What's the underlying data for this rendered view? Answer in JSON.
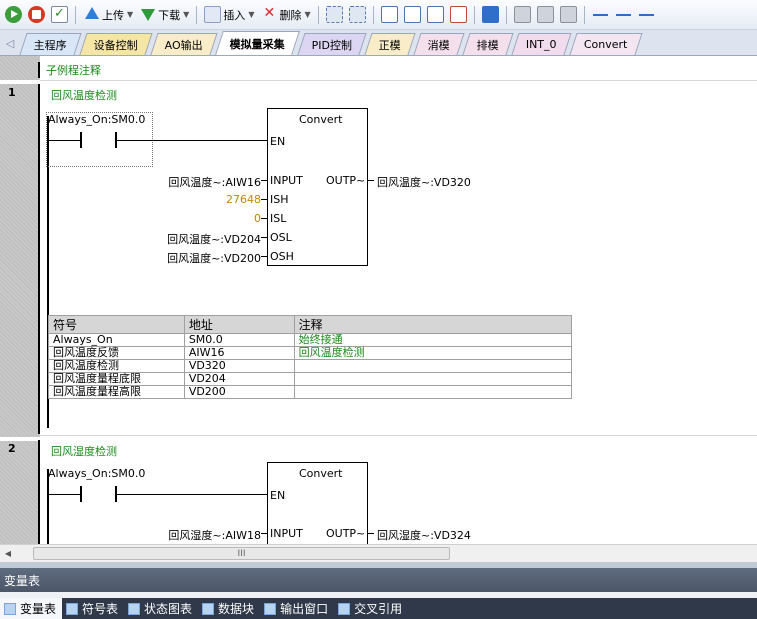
{
  "toolbar": {
    "upload_label": "上传",
    "download_label": "下载",
    "insert_label": "插入",
    "delete_label": "删除"
  },
  "tabs": [
    {
      "label": "主程序",
      "color": "#d8e6f8"
    },
    {
      "label": "设备控制",
      "color": "#f5e6a6"
    },
    {
      "label": "AO输出",
      "color": "#f8ecc9"
    },
    {
      "label": "模拟量采集",
      "color": "#ffffff"
    },
    {
      "label": "PID控制",
      "color": "#dcd6f2"
    },
    {
      "label": "正模",
      "color": "#f8ecc9"
    },
    {
      "label": "消模",
      "color": "#f3e0ec"
    },
    {
      "label": "排模",
      "color": "#f3e0ec"
    },
    {
      "label": "INT_0",
      "color": "#f0dcec"
    },
    {
      "label": "Convert",
      "color": "#f3e6f2"
    }
  ],
  "editor": {
    "subroutine_comment": "子例程注释",
    "networks": [
      {
        "number": "1",
        "title": "回风温度检测",
        "contact_label": "Always_On:SM0.0",
        "block_title": "Convert",
        "en_label": "EN",
        "input_label": "INPUT",
        "outp_label": "OUTP~",
        "ish_label": "ISH",
        "isl_label": "ISL",
        "osl_label": "OSL",
        "osh_label": "OSH",
        "input_operand": "回风温度~:AIW16",
        "output_operand": "回风温度~:VD320",
        "ish_value": "27648",
        "isl_value": "0",
        "osl_operand": "回风温度~:VD204",
        "osh_operand": "回风温度~:VD200",
        "symbol_table": {
          "headers": [
            "符号",
            "地址",
            "注释"
          ],
          "rows": [
            [
              "Always_On",
              "SM0.0",
              "始终接通"
            ],
            [
              "回风温度反馈",
              "AIW16",
              "回风温度检测"
            ],
            [
              "回风温度检测",
              "VD320",
              ""
            ],
            [
              "回风温度量程底限",
              "VD204",
              ""
            ],
            [
              "回风温度量程高限",
              "VD200",
              ""
            ]
          ]
        }
      },
      {
        "number": "2",
        "title": "回风湿度检测",
        "contact_label": "Always_On:SM0.0",
        "block_title": "Convert",
        "en_label": "EN",
        "input_label": "INPUT",
        "outp_label": "OUTP~",
        "input_operand": "回风湿度~:AIW18",
        "output_operand": "回风湿度~:VD324"
      }
    ]
  },
  "scrollbar": {
    "thumb_grip": "III"
  },
  "panel": {
    "title": "变量表"
  },
  "bottom_tabs": [
    {
      "label": "变量表",
      "active": true
    },
    {
      "label": "符号表"
    },
    {
      "label": "状态图表"
    },
    {
      "label": "数据块"
    },
    {
      "label": "输出窗口"
    },
    {
      "label": "交叉引用"
    }
  ]
}
